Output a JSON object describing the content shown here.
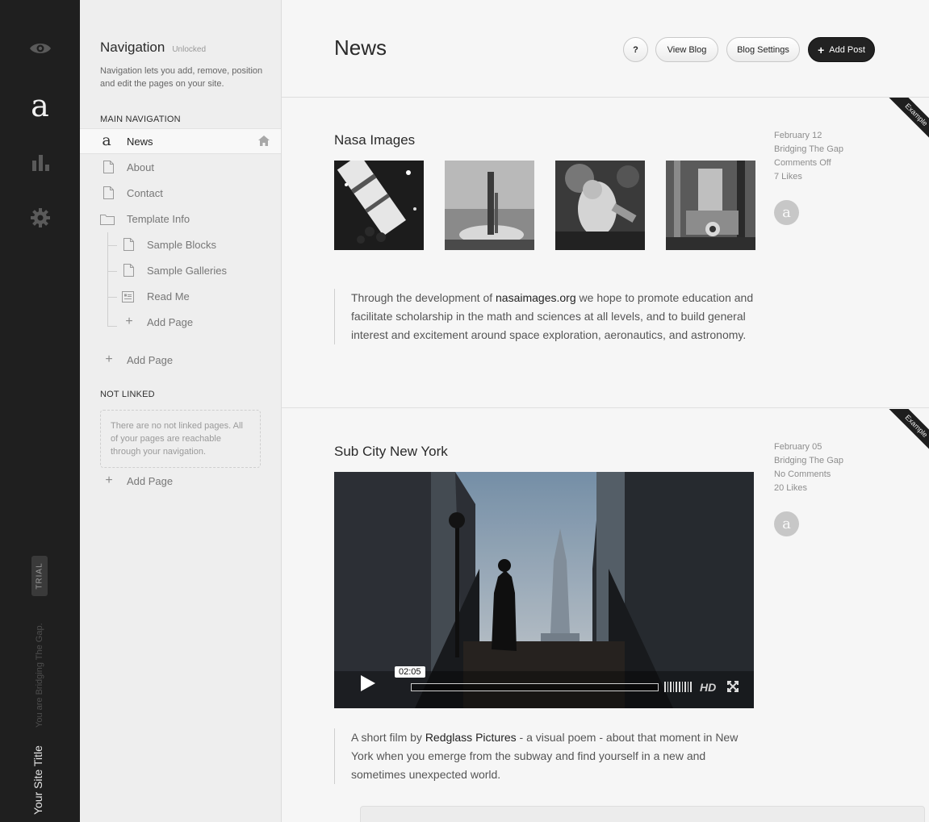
{
  "rail": {
    "icons": [
      "eye-icon",
      "logo-icon",
      "stats-icon",
      "gear-icon"
    ],
    "logo": "a",
    "trial_badge": "TRIAL",
    "bridging_text": "You are Bridging The Gap.",
    "site_title": "Your Site Title"
  },
  "navigation": {
    "title": "Navigation",
    "status": "Unlocked",
    "description": "Navigation lets you add, remove, position and edit the pages on your site.",
    "main_heading": "MAIN NAVIGATION",
    "items": [
      {
        "label": "News",
        "icon": "blog-icon",
        "active": true
      },
      {
        "label": "About",
        "icon": "page-icon"
      },
      {
        "label": "Contact",
        "icon": "page-icon"
      },
      {
        "label": "Template Info",
        "icon": "folder-icon"
      },
      {
        "label": "Sample Blocks",
        "icon": "page-icon"
      },
      {
        "label": "Sample Galleries",
        "icon": "page-icon"
      },
      {
        "label": "Read Me",
        "icon": "text-icon"
      },
      {
        "label": "Add Page",
        "icon": "plus-icon"
      }
    ],
    "add_page": "Add Page",
    "not_linked_heading": "NOT LINKED",
    "not_linked_empty": "There are no not linked pages. All of your pages are reachable through your navigation.",
    "not_linked_add": "Add Page"
  },
  "header": {
    "title": "News",
    "help_label": "?",
    "view_blog_label": "View Blog",
    "blog_settings_label": "Blog Settings",
    "add_post_label": "Add Post"
  },
  "posts": [
    {
      "title": "Nasa Images",
      "ribbon": "Example",
      "date": "February 12",
      "author": "Bridging The Gap",
      "comments": "Comments Off",
      "likes": "7 Likes",
      "avatar": "a",
      "body_before": "Through the development of ",
      "link": "nasaimages.org",
      "body_after": " we hope to promote education and facilitate scholarship in the math and sciences at all levels, and to build general interest and excitement around space exploration, aeronautics, and astronomy."
    },
    {
      "title": "Sub City New York",
      "ribbon": "Example",
      "date": "February 05",
      "author": "Bridging The Gap",
      "comments": "No Comments",
      "likes": "20 Likes",
      "avatar": "a",
      "video_time": "02:05",
      "video_quality": "HD",
      "body_before": "A short film by ",
      "link": "Redglass Pictures",
      "body_after": " - a visual poem - about that moment in New York when you emerge from the subway and find yourself in a new and sometimes unexpected world."
    }
  ],
  "colors": {
    "rail_bg": "#1f1f1f",
    "nav_bg": "#eeeeee",
    "main_bg": "#f6f6f6",
    "primary_button": "#222222"
  }
}
